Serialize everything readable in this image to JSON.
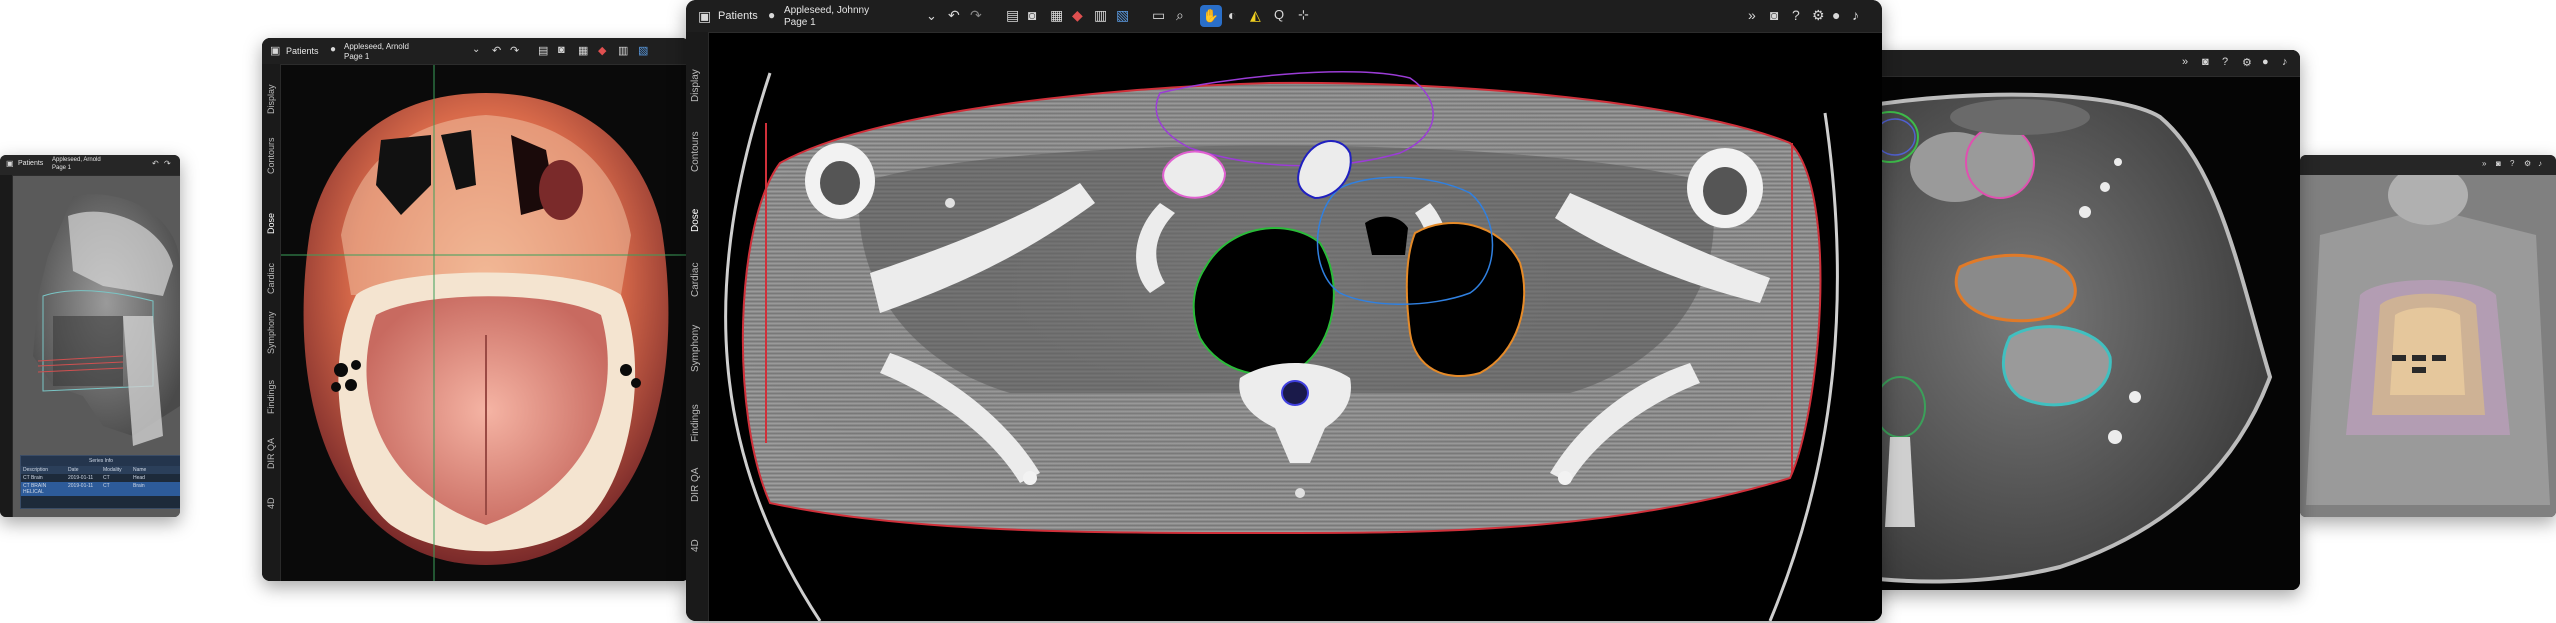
{
  "app": {
    "patients_label": "Patients",
    "patient_name_main": "Appleseed, Johnny",
    "page_label": "Page 1",
    "patient_name_second": "Appleseed, Arnold",
    "patient_name_far_left": "Appleseed, Arnold"
  },
  "side_tabs": [
    "Display",
    "Contours",
    "Dose",
    "Cardiac",
    "Symphony",
    "Findings",
    "DIR QA",
    "4D"
  ],
  "side_tabs_second": [
    "Display",
    "Contours",
    "Dose",
    "Cardiac",
    "Symphony",
    "Findings",
    "DIR QA",
    "4D"
  ],
  "table_panel": {
    "title": "Series Info",
    "columns": [
      "Description",
      "Date",
      "Modality",
      "Name"
    ],
    "rows": [
      [
        "CT Brain",
        "2019-01-11",
        "CT",
        "Head"
      ],
      [
        "CT BRAIN HELICAL",
        "2019-01-11",
        "CT",
        "Brain"
      ]
    ]
  },
  "colors": {
    "accent": "#2a6fc9",
    "body_contour": "#d0303a",
    "lung_left": "#2bbb3a",
    "lung_right": "#e58a28",
    "thyroid": "#9b3cd6",
    "vessel_pink": "#e060d0",
    "esophagus_blue": "#3080e0",
    "cord": "#4040e0"
  }
}
